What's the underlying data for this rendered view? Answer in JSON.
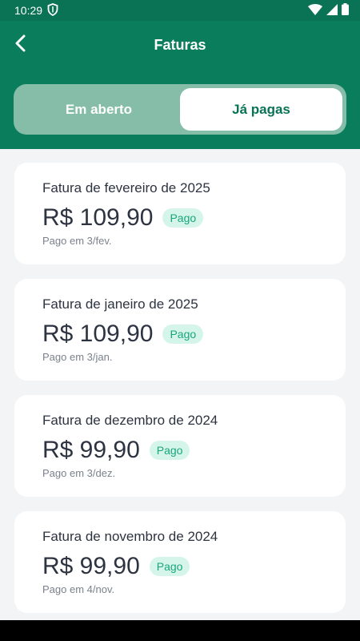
{
  "status_bar": {
    "time": "10:29"
  },
  "header": {
    "title": "Faturas",
    "tabs": [
      {
        "label": "Em aberto",
        "active": false
      },
      {
        "label": "Já pagas",
        "active": true
      }
    ]
  },
  "colors": {
    "brand": "#0a7e5c",
    "status_bar": "#0a7355",
    "tab_track": "#85bda9",
    "badge_bg": "#d6f5ea",
    "badge_text": "#19a67a"
  },
  "invoices": [
    {
      "title": "Fatura de fevereiro de 2025",
      "amount": "R$ 109,90",
      "status": "Pago",
      "paid_on": "Pago em 3/fev."
    },
    {
      "title": "Fatura de janeiro de 2025",
      "amount": "R$ 109,90",
      "status": "Pago",
      "paid_on": "Pago em 3/jan."
    },
    {
      "title": "Fatura de dezembro de 2024",
      "amount": "R$ 99,90",
      "status": "Pago",
      "paid_on": "Pago em 3/dez."
    },
    {
      "title": "Fatura de novembro de 2024",
      "amount": "R$ 99,90",
      "status": "Pago",
      "paid_on": "Pago em 4/nov."
    }
  ]
}
